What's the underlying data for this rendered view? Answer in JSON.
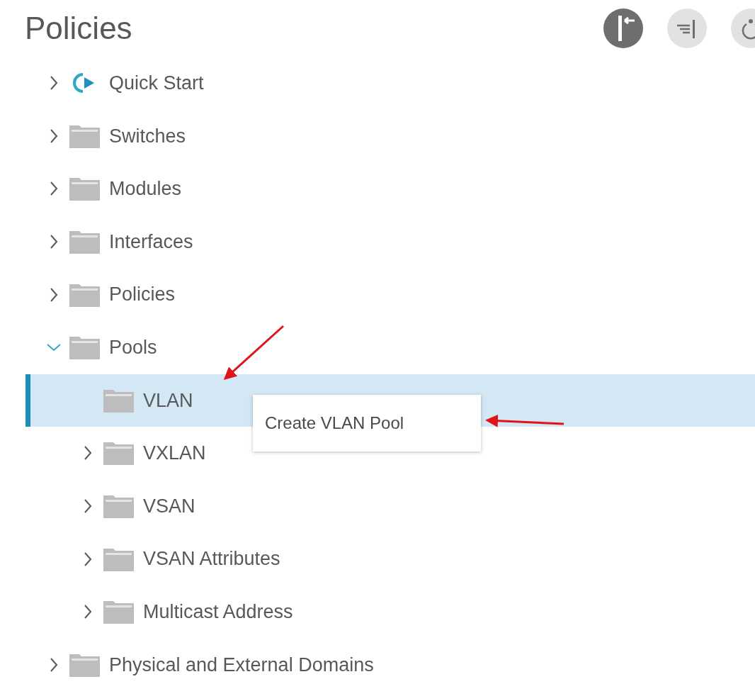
{
  "header": {
    "title": "Policies"
  },
  "tree": [
    {
      "label": "Quick Start",
      "kind": "start",
      "expanded": false,
      "selected": false
    },
    {
      "label": "Switches",
      "kind": "folder",
      "expanded": false,
      "selected": false
    },
    {
      "label": "Modules",
      "kind": "folder",
      "expanded": false,
      "selected": false
    },
    {
      "label": "Interfaces",
      "kind": "folder",
      "expanded": false,
      "selected": false
    },
    {
      "label": "Policies",
      "kind": "folder",
      "expanded": false,
      "selected": false
    },
    {
      "label": "Pools",
      "kind": "folder",
      "expanded": true,
      "selected": false,
      "children": [
        {
          "label": "VLAN",
          "kind": "folder",
          "selected": true
        },
        {
          "label": "VXLAN",
          "kind": "folder",
          "expanded": false,
          "selected": false
        },
        {
          "label": "VSAN",
          "kind": "folder",
          "expanded": false,
          "selected": false
        },
        {
          "label": "VSAN Attributes",
          "kind": "folder",
          "expanded": false,
          "selected": false
        },
        {
          "label": "Multicast Address",
          "kind": "folder",
          "expanded": false,
          "selected": false
        }
      ]
    },
    {
      "label": "Physical and External Domains",
      "kind": "folder",
      "expanded": false,
      "selected": false
    }
  ],
  "context_menu": {
    "items": [
      "Create VLAN Pool"
    ]
  }
}
